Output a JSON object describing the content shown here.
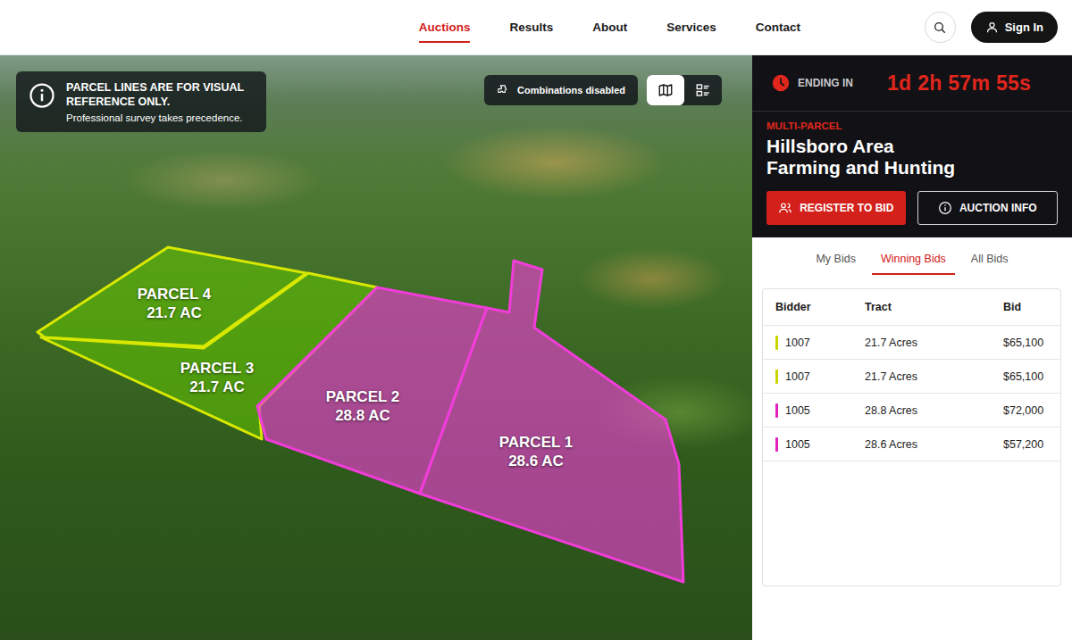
{
  "nav": {
    "items": [
      {
        "label": "Auctions",
        "selected": true
      },
      {
        "label": "Results",
        "selected": false
      },
      {
        "label": "About",
        "selected": false
      },
      {
        "label": "Services",
        "selected": false
      },
      {
        "label": "Contact",
        "selected": false
      }
    ],
    "sign_in": "Sign In"
  },
  "map": {
    "notice_title": "PARCEL LINES ARE FOR VISUAL REFERENCE ONLY.",
    "notice_text": "Professional survey takes precedence.",
    "combinations": "Combinations disabled",
    "views": [
      {
        "selected": true
      },
      {
        "selected": false
      }
    ],
    "parcels": [
      {
        "name": "PARCEL 4",
        "acres": "21.7 AC",
        "color": "#d8e800"
      },
      {
        "name": "PARCEL 3",
        "acres": "21.7 AC",
        "color": "#d8e800"
      },
      {
        "name": "PARCEL 2",
        "acres": "28.8 AC",
        "color": "#f03cd8"
      },
      {
        "name": "PARCEL 1",
        "acres": "28.6 AC",
        "color": "#f03cd8"
      }
    ]
  },
  "auction": {
    "countdown_label": "ENDING IN",
    "countdown": "1d 2h 57m 55s",
    "type": "MULTI-PARCEL",
    "title_lines": [
      "Hillsboro Area",
      "Farming and Hunting"
    ],
    "buttons": [
      "REGISTER TO BID",
      "AUCTION INFO"
    ]
  },
  "bid_tabs": [
    {
      "label": "My Bids",
      "selected": false
    },
    {
      "label": "Winning Bids",
      "selected": true
    },
    {
      "label": "All Bids",
      "selected": false
    }
  ],
  "table": {
    "columns": [
      "Bidder",
      "Tract",
      "Bid"
    ],
    "rows": [
      {
        "bidder": "1007",
        "tract": "21.7 Acres",
        "bid": "$65,100",
        "color": "#c8d400"
      },
      {
        "bidder": "1007",
        "tract": "21.7 Acres",
        "bid": "$65,100",
        "color": "#c8d400"
      },
      {
        "bidder": "1005",
        "tract": "28.8 Acres",
        "bid": "$72,000",
        "color": "#e020c0"
      },
      {
        "bidder": "1005",
        "tract": "28.6 Acres",
        "bid": "$57,200",
        "color": "#e020c0"
      }
    ]
  }
}
